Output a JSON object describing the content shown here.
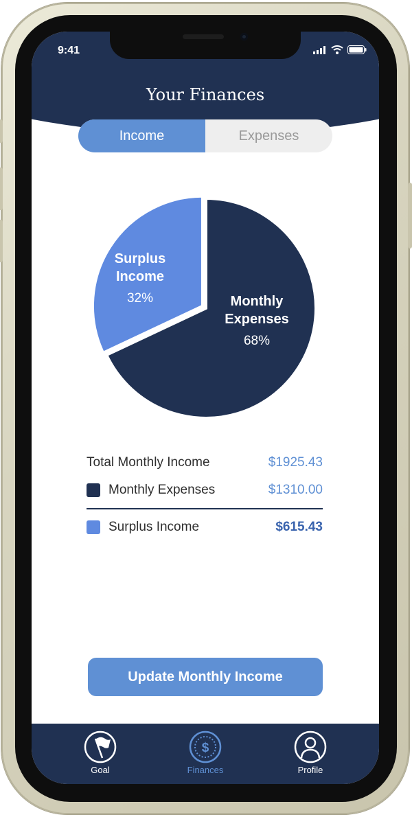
{
  "status_bar": {
    "time": "9:41"
  },
  "header": {
    "title": "Your Finances"
  },
  "segment": {
    "income_label": "Income",
    "expenses_label": "Expenses",
    "active": "Income"
  },
  "chart_data": {
    "type": "pie",
    "slices": [
      {
        "label": "Monthly Expenses",
        "label_line1": "Monthly",
        "label_line2": "Expenses",
        "value": 68,
        "display": "68%",
        "color": "#203152"
      },
      {
        "label": "Surplus Income",
        "label_line1": "Surplus",
        "label_line2": "Income",
        "value": 32,
        "display": "32%",
        "color": "#5f8ae0"
      }
    ]
  },
  "summary": {
    "total_label": "Total Monthly Income",
    "total_value": "$1925.43",
    "expenses_label": "Monthly Expenses",
    "expenses_value": "$1310.00",
    "surplus_label": "Surplus Income",
    "surplus_value": "$615.43"
  },
  "button": {
    "label": "Update Monthly Income"
  },
  "tabbar": {
    "items": [
      {
        "label": "Goal",
        "icon": "flag-icon"
      },
      {
        "label": "Finances",
        "icon": "dollar-icon"
      },
      {
        "label": "Profile",
        "icon": "user-icon"
      }
    ],
    "active": "Finances"
  },
  "colors": {
    "navy": "#203152",
    "accent": "#5f90d4",
    "surplus": "#5f8ae0"
  }
}
